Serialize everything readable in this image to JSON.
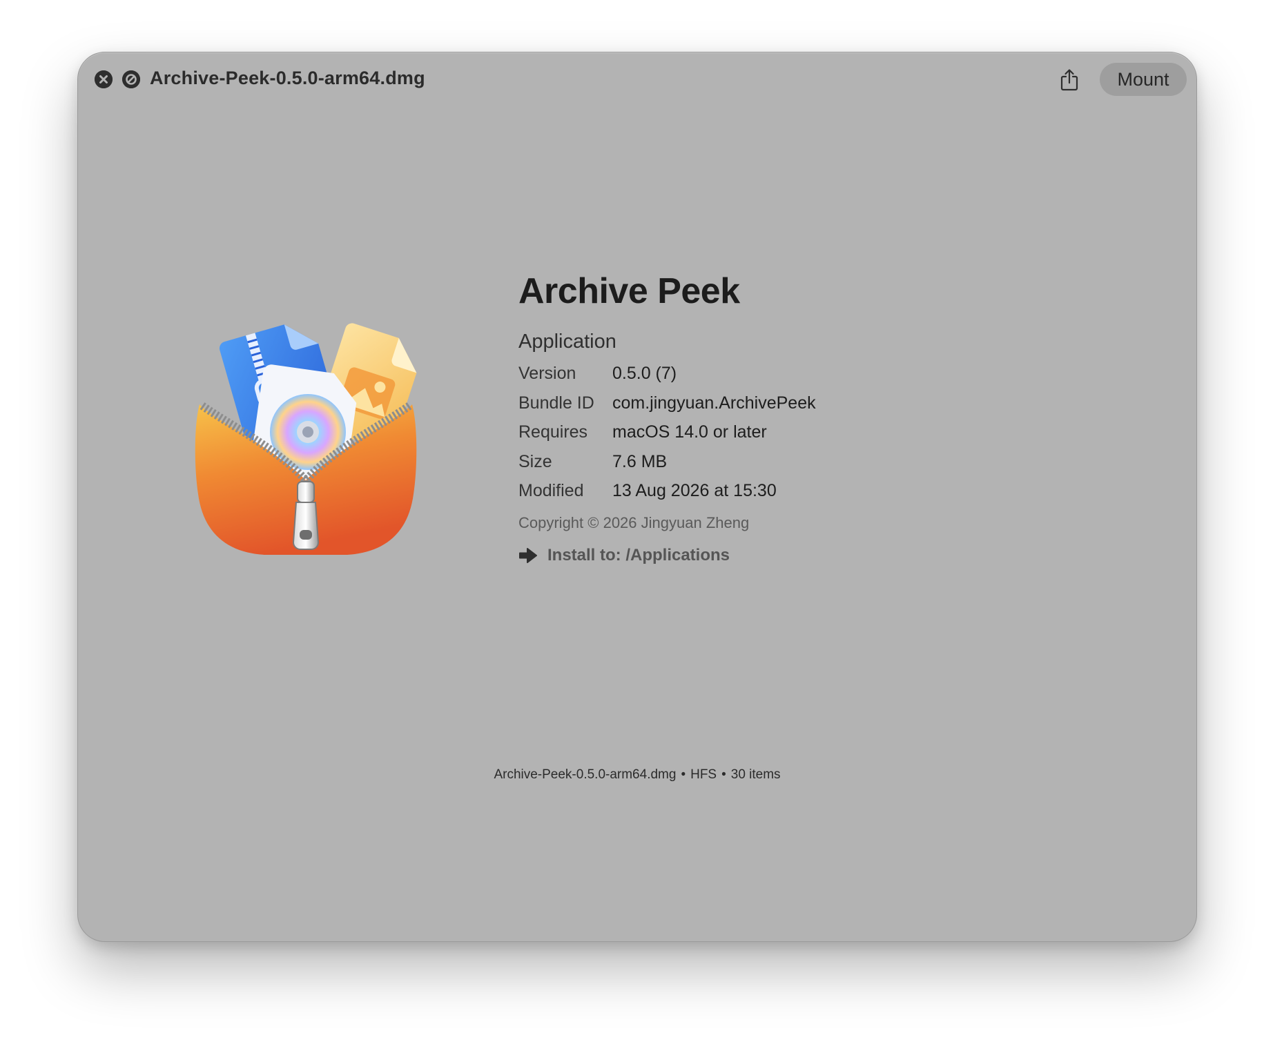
{
  "window": {
    "title": "Archive-Peek-0.5.0-arm64.dmg"
  },
  "toolbar": {
    "share_icon": "share-icon",
    "mount_label": "Mount"
  },
  "app": {
    "name": "Archive Peek",
    "kind": "Application",
    "icon": "archive-zip-pouch-icon",
    "details": [
      {
        "label": "Version",
        "value": "0.5.0 (7)"
      },
      {
        "label": "Bundle ID",
        "value": "com.jingyuan.ArchivePeek"
      },
      {
        "label": "Requires",
        "value": "macOS 14.0 or later"
      },
      {
        "label": "Size",
        "value": "7.6 MB"
      },
      {
        "label": "Modified",
        "value": "13 Aug 2026 at 15:30"
      }
    ],
    "copyright": "Copyright © 2026 Jingyuan Zheng",
    "install_label": "Install to: /Applications"
  },
  "footer": {
    "file": "Archive-Peek-0.5.0-arm64.dmg",
    "format": "HFS",
    "items": "30 items",
    "separator": "•"
  },
  "colors": {
    "window_bg": "#b3b3b3",
    "mount_button_bg": "#9e9e9e",
    "text_primary": "#1c1c1c",
    "text_secondary": "#5a5a5a"
  }
}
